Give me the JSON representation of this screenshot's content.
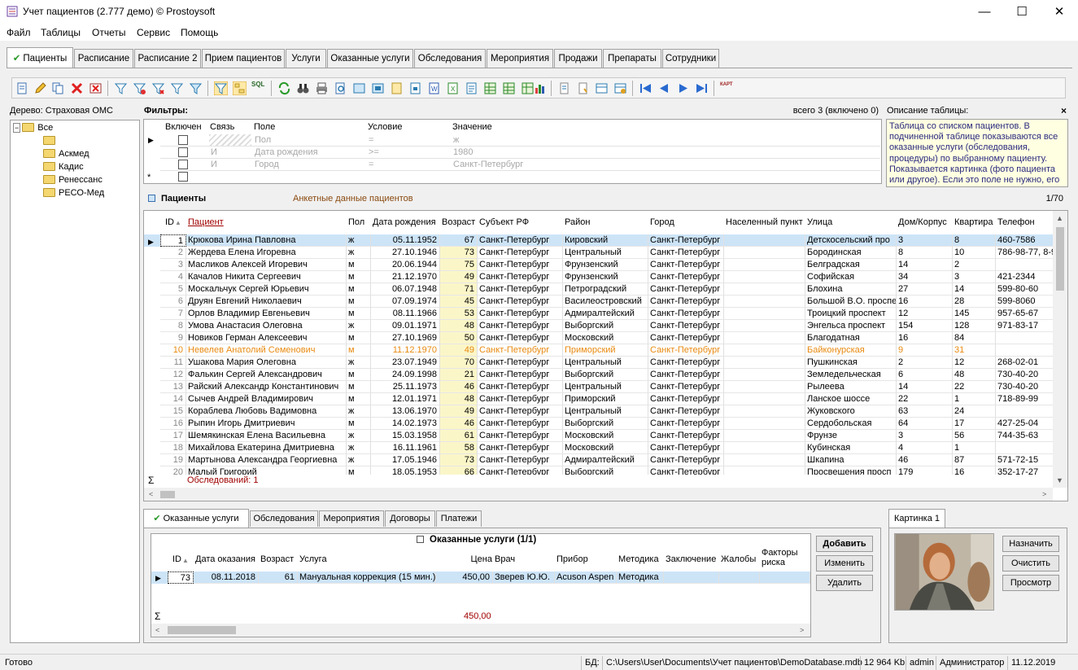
{
  "window": {
    "title": "Учет пациентов (2.777 демо) © Prostoysoft"
  },
  "menu": [
    "Файл",
    "Таблицы",
    "Отчеты",
    "Сервис",
    "Помощь"
  ],
  "main_tabs": [
    "Пациенты",
    "Расписание",
    "Расписание 2",
    "Прием пациентов",
    "Услуги",
    "Оказанные услуги",
    "Обследования",
    "Мероприятия",
    "Продажи",
    "Препараты",
    "Сотрудники"
  ],
  "toolbar_sql": "SQL",
  "toolbar_kart": "КАРТ",
  "tree": {
    "header": "Дерево: Страховая ОМС",
    "root": "Все",
    "items": [
      "",
      "Аскмед",
      "Кадис",
      "Ренессанс",
      "РЕСО-Мед"
    ]
  },
  "filters": {
    "title": "Фильтры:",
    "total": "всего 3 (включено 0)",
    "columns": [
      "Включен",
      "Связь",
      "Поле",
      "Условие",
      "Значение"
    ],
    "rows": [
      {
        "link": "",
        "field": "Пол",
        "cond": "=",
        "value": "ж"
      },
      {
        "link": "И",
        "field": "Дата рождения",
        "cond": ">=",
        "value": "1980"
      },
      {
        "link": "И",
        "field": "Город",
        "cond": "=",
        "value": "Санкт-Петербург"
      }
    ],
    "new_row_marker": "*"
  },
  "description": {
    "title": "Описание таблицы:",
    "close": "×",
    "text": "Таблица со списком пациентов. В подчиненной таблице показываются все оказанные услуги (обследования, процедуры) по выбранному пациенту. Показывается картинка (фото пациента или другое). Если это поле не нужно, его"
  },
  "patients": {
    "title": "Пациенты",
    "subtitle": "Анкетные данные пациентов",
    "counter": "1/70",
    "columns": [
      "ID",
      "Пациент",
      "Пол",
      "Дата рождения",
      "Возраст",
      "Субъект РФ",
      "Район",
      "Город",
      "Населенный пункт",
      "Улица",
      "Дом/Корпус",
      "Квартира",
      "Телефон"
    ],
    "rows": [
      [
        "1",
        "Крюкова Ирина Павловна",
        "ж",
        "05.11.1952",
        "67",
        "Санкт-Петербург",
        "Кировский",
        "Санкт-Петербург",
        "",
        "Детскосельский про",
        "3",
        "8",
        "460-7586"
      ],
      [
        "2",
        "Жердева Елена Игоревна",
        "ж",
        "27.10.1946",
        "73",
        "Санкт-Петербург",
        "Центральный",
        "Санкт-Петербург",
        "",
        "Бородинская",
        "8",
        "10",
        "786-98-77, 8-9"
      ],
      [
        "3",
        "Масликов Алексей Игоревич",
        "м",
        "20.06.1944",
        "75",
        "Санкт-Петербург",
        "Фрунзенский",
        "Санкт-Петербург",
        "",
        "Белградская",
        "14",
        "2",
        ""
      ],
      [
        "4",
        "Качалов Никита Сергеевич",
        "м",
        "21.12.1970",
        "49",
        "Санкт-Петербург",
        "Фрунзенский",
        "Санкт-Петербург",
        "",
        "Софийская",
        "34",
        "3",
        "421-2344"
      ],
      [
        "5",
        "Москальчук Сергей Юрьевич",
        "м",
        "06.07.1948",
        "71",
        "Санкт-Петербург",
        "Петроградский",
        "Санкт-Петербург",
        "",
        "Блохина",
        "27",
        "14",
        "599-80-60"
      ],
      [
        "6",
        "Друян Евгений Николаевич",
        "м",
        "07.09.1974",
        "45",
        "Санкт-Петербург",
        "Василеостровский",
        "Санкт-Петербург",
        "",
        "Большой В.О. проспе",
        "16",
        "28",
        "599-8060"
      ],
      [
        "7",
        "Орлов Владимир Евгеньевич",
        "м",
        "08.11.1966",
        "53",
        "Санкт-Петербург",
        "Адмиралтейский",
        "Санкт-Петербург",
        "",
        "Троицкий проспект",
        "12",
        "145",
        "957-65-67"
      ],
      [
        "8",
        "Умова Анастасия Олеговна",
        "ж",
        "09.01.1971",
        "48",
        "Санкт-Петербург",
        "Выборгский",
        "Санкт-Петербург",
        "",
        "Энгельса проспект",
        "154",
        "128",
        "971-83-17"
      ],
      [
        "9",
        "Новиков Герман Алексеевич",
        "м",
        "27.10.1969",
        "50",
        "Санкт-Петербург",
        "Московский",
        "Санкт-Петербург",
        "",
        "Благодатная",
        "16",
        "84",
        ""
      ],
      [
        "10",
        "Невелев Анатолий Семенович",
        "м",
        "11.12.1970",
        "49",
        "Санкт-Петербург",
        "Приморский",
        "Санкт-Петербург",
        "",
        "Байконурская",
        "9",
        "31",
        ""
      ],
      [
        "11",
        "Ушакова Мария Олеговна",
        "ж",
        "23.07.1949",
        "70",
        "Санкт-Петербург",
        "Центральный",
        "Санкт-Петербург",
        "",
        "Пушкинская",
        "2",
        "12",
        "268-02-01"
      ],
      [
        "12",
        "Фалькин Сергей Александрович",
        "м",
        "24.09.1998",
        "21",
        "Санкт-Петербург",
        "Выборгский",
        "Санкт-Петербург",
        "",
        "Земледельческая",
        "6",
        "48",
        "730-40-20"
      ],
      [
        "13",
        "Райский Александр Константинович",
        "м",
        "25.11.1973",
        "46",
        "Санкт-Петербург",
        "Центральный",
        "Санкт-Петербург",
        "",
        "Рылеева",
        "14",
        "22",
        "730-40-20"
      ],
      [
        "14",
        "Сычев Андрей Владимирович",
        "м",
        "12.01.1971",
        "48",
        "Санкт-Петербург",
        "Приморский",
        "Санкт-Петербург",
        "",
        "Ланское шоссе",
        "22",
        "1",
        "718-89-99"
      ],
      [
        "15",
        "Кораблева Любовь Вадимовна",
        "ж",
        "13.06.1970",
        "49",
        "Санкт-Петербург",
        "Центральный",
        "Санкт-Петербург",
        "",
        "Жуковского",
        "63",
        "24",
        ""
      ],
      [
        "16",
        "Рыпин Игорь Дмитриевич",
        "м",
        "14.02.1973",
        "46",
        "Санкт-Петербург",
        "Выборгский",
        "Санкт-Петербург",
        "",
        "Сердобольская",
        "64",
        "17",
        "427-25-04"
      ],
      [
        "17",
        "Шемякинская Елена Васильевна",
        "ж",
        "15.03.1958",
        "61",
        "Санкт-Петербург",
        "Московский",
        "Санкт-Петербург",
        "",
        "Фрунзе",
        "3",
        "56",
        "744-35-63"
      ],
      [
        "18",
        "Михайлова Екатерина Дмитриевна",
        "ж",
        "16.11.1961",
        "58",
        "Санкт-Петербург",
        "Московский",
        "Санкт-Петербург",
        "",
        "Кубинская",
        "4",
        "1",
        ""
      ],
      [
        "19",
        "Мартынова Александра Георгиевна",
        "ж",
        "17.05.1946",
        "73",
        "Санкт-Петербург",
        "Адмиралтейский",
        "Санкт-Петербург",
        "",
        "Шкапина",
        "46",
        "87",
        "571-72-15"
      ],
      [
        "20",
        "Малый Григорий",
        "м",
        "18.05.1953",
        "66",
        "Санкт-Петербург",
        "Выборгский",
        "Санкт-Петербург",
        "",
        "Просвещения просп",
        "179",
        "16",
        "352-17-27"
      ]
    ],
    "highlight_row": 10,
    "summary": "Обследований: 1",
    "sigma": "Σ"
  },
  "sub_tabs": [
    "Оказанные услуги",
    "Обследования",
    "Мероприятия",
    "Договоры",
    "Платежи"
  ],
  "services": {
    "title": "Оказанные услуги (1/1)",
    "columns": [
      "ID",
      "Дата оказания",
      "Возраст",
      "Услуга",
      "Цена",
      "Врач",
      "Прибор",
      "Методика",
      "Заключение",
      "Жалобы",
      "Факторы риска"
    ],
    "rows": [
      [
        "73",
        "08.11.2018",
        "61",
        "Мануальная коррекция (15 мин.)",
        "450,00",
        "Зверев Ю.Ю.",
        "Acuson Aspen",
        "Методика",
        "",
        "",
        ""
      ]
    ],
    "total": "450,00",
    "sigma": "Σ",
    "buttons": [
      "Добавить",
      "Изменить",
      "Удалить"
    ]
  },
  "image_panel": {
    "tab": "Картинка 1",
    "buttons": [
      "Назначить",
      "Очистить",
      "Просмотр"
    ]
  },
  "status": {
    "ready": "Готово",
    "db_label": "БД:",
    "db_path": "C:\\Users\\User\\Documents\\Учет пациентов\\DemoDatabase.mdb",
    "size": "12 964 Kb",
    "user": "admin",
    "role": "Администратор",
    "date": "11.12.2019"
  },
  "colors": {
    "highlight_row": "#e88a10",
    "selected_row": "#cde4f7",
    "age_col": "#fbf6c8",
    "accent": "#2a9a2a"
  }
}
